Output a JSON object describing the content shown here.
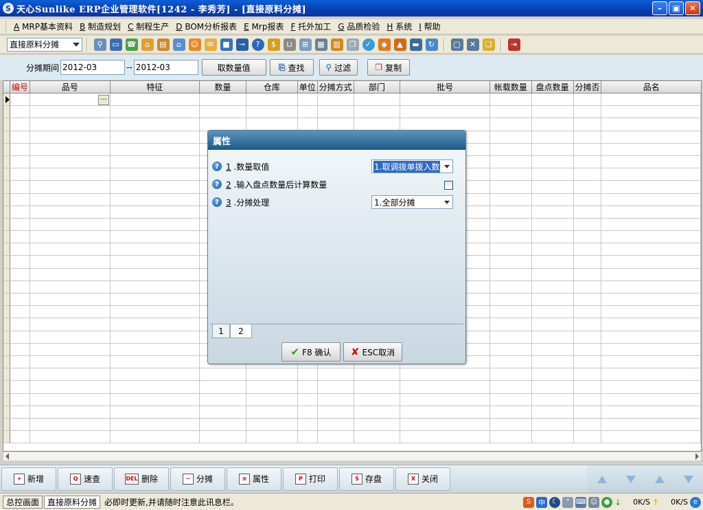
{
  "window": {
    "title": "天心Sunlike ERP企业管理软件[1242 - 李秀芳] - [直接原料分摊]"
  },
  "menu": [
    {
      "key": "A",
      "label": " MRP基本资料"
    },
    {
      "key": "B",
      "label": " 制造规划"
    },
    {
      "key": "C",
      "label": " 制程生产"
    },
    {
      "key": "D",
      "label": " BOM分析报表"
    },
    {
      "key": "E",
      "label": " Mrp报表"
    },
    {
      "key": "F",
      "label": " 托外加工"
    },
    {
      "key": "G",
      "label": " 品质检验"
    },
    {
      "key": "H",
      "label": " 系统"
    },
    {
      "key": "I",
      "label": " 帮助"
    }
  ],
  "toolbar": {
    "combo_value": "直接原料分摊",
    "icons": [
      "tree-icon",
      "monitor-icon",
      "phone-icon",
      "home-doc-icon",
      "briefcase-icon",
      "house-icon",
      "people-icon",
      "mail-icon",
      "bookmark-icon",
      "pin-icon",
      "help-circle-icon",
      "dollar-icon",
      "cart-icon",
      "report-icon",
      "calculator-icon",
      "box-icon",
      "copy-icon",
      "globe-icon",
      "bell-icon",
      "chart-icon",
      "screen-icon",
      "refresh-icon",
      "window-icon",
      "close-window-icon",
      "windows-icon",
      "exit-icon"
    ]
  },
  "filter": {
    "label": "分摊期间",
    "from": "2012-03",
    "sep": "--",
    "to": "2012-03",
    "btn_take_qty": "取数量值",
    "btn_search": "查找",
    "btn_filter": "过滤",
    "btn_copy": "复制"
  },
  "grid": {
    "columns": [
      "编号",
      "品号",
      "特征",
      "数量",
      "仓库",
      "单位",
      "分摊方式",
      "部门",
      "批号",
      "帐载数量",
      "盘点数量",
      "分摊否",
      "品名"
    ]
  },
  "actions": [
    "新增",
    "速查",
    "删除",
    "分摊",
    "属性",
    "打印",
    "存盘",
    "关闭"
  ],
  "action_icons": [
    "+",
    "Q",
    "DEL",
    "~",
    "≡",
    "P",
    "S",
    "X"
  ],
  "status": {
    "tabs": [
      "总控画面",
      "直接原料分摊"
    ],
    "message": "必即时更新,并请随时注意此讯息栏。",
    "tray_ok1": "0K/S",
    "tray_ok2": "0K/S"
  },
  "dialog": {
    "title": "属性",
    "props": [
      {
        "num": "1",
        "label": " .数量取值",
        "value": "1.取调拨单拨入数"
      },
      {
        "num": "2",
        "label": " .输入盘点数量后计算数量",
        "checked": false
      },
      {
        "num": "3",
        "label": " .分摊处理",
        "value": "1.全部分摊"
      }
    ],
    "tabs": [
      "1",
      "2"
    ],
    "ok": "F8 确认",
    "cancel": "ESC取消"
  }
}
